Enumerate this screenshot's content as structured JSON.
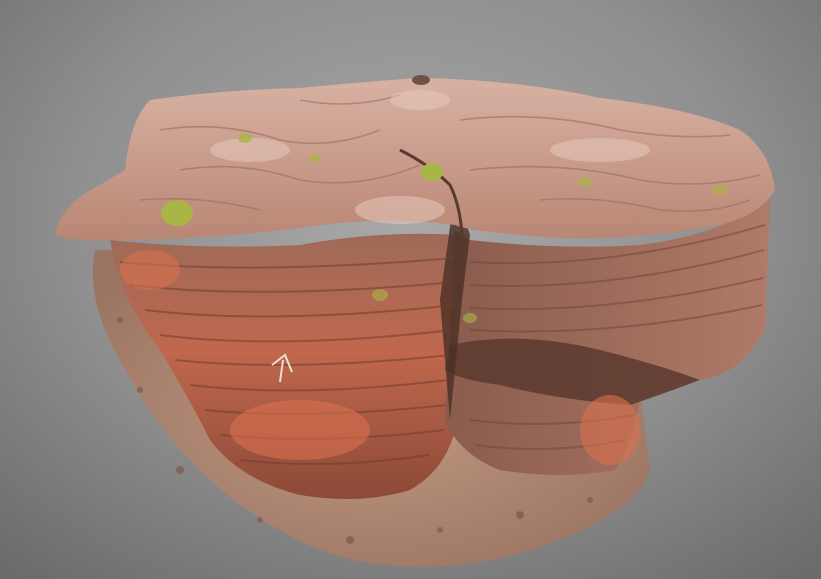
{
  "scene": {
    "subject": "sandstone-rock-formation",
    "colors": {
      "background_center": "#a9a9a9",
      "background_edge": "#6b6b6b",
      "rock_top": "#c9a090",
      "rock_face": "#c0674d",
      "rock_shadow": "#5a3a2e",
      "ground": "#b88c76",
      "moss": "#a9b545"
    }
  }
}
